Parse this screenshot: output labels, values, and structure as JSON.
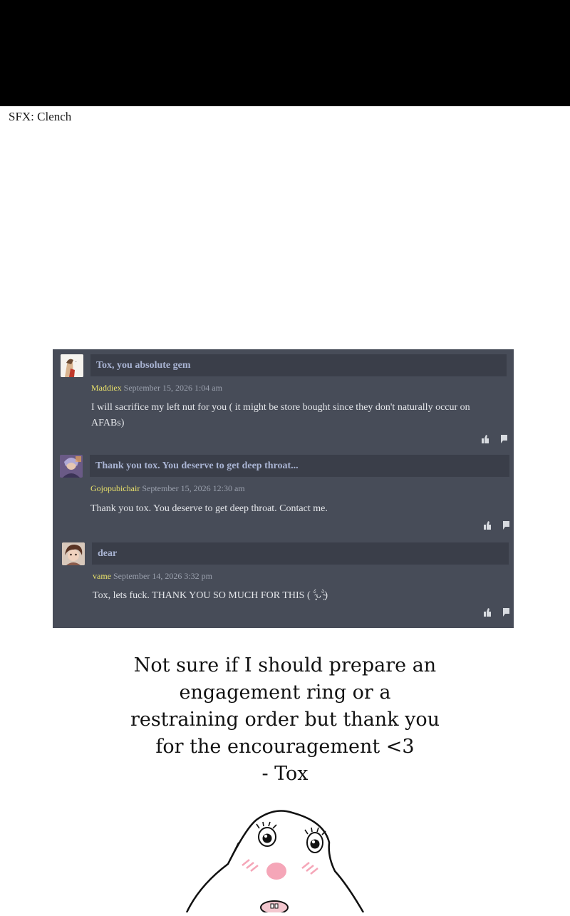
{
  "sfx": "SFX: Clench",
  "comments": [
    {
      "title": "Tox, you absolute gem",
      "author": "Maddiex",
      "date": "September 15, 2026 1:04 am",
      "text": "I will sacrifice my left nut for you ( it might be store bought since they don't naturally occur on AFABs)"
    },
    {
      "title": "Thank you tox. You deserve to get deep throat...",
      "author": "Gojopubichair",
      "date": "September 15, 2026 12:30 am",
      "text": "Thank you tox. You deserve to get deep throat. Contact me."
    },
    {
      "title": "dear",
      "author": "vame",
      "date": "September 14, 2026 3:32 pm",
      "text": "Tox, lets fuck. THANK YOU SO MUCH FOR THIS ( ˘̴͈́ᴗ˘̴͈̀)"
    }
  ],
  "reply": {
    "line1": "Not sure if I should prepare an",
    "line2": "engagement ring or a",
    "line3": "restraining order but thank you",
    "line4": "for the encouragement <3",
    "line5": "- Tox"
  },
  "colors": {
    "panel": "#474c58",
    "title_bar": "#3a3e49",
    "title_text": "#a9b4d3",
    "author": "#e8e06a",
    "date": "#9aa0ad"
  },
  "icons": [
    "thumbs-up-icon",
    "flag-icon"
  ]
}
